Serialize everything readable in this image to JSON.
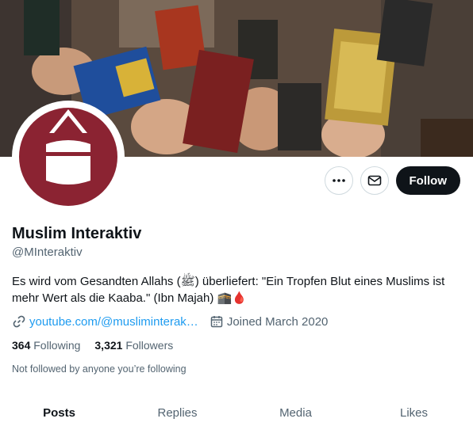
{
  "banner": {
    "description_icon": "crowd-holding-qurans-photo"
  },
  "avatar": {
    "icon": "kaaba-drop-logo",
    "color": "#8b2332"
  },
  "actions": {
    "more_icon": "ellipsis-icon",
    "message_icon": "envelope-icon",
    "follow_label": "Follow"
  },
  "profile": {
    "name": "Muslim Interaktiv",
    "handle": "@MInteraktiv",
    "bio": "Es wird vom Gesandten Allahs (ﷺ) überliefert: \"Ein Tropfen Blut eines Muslims ist mehr Wert als die Kaaba.\"  (Ibn Majah) 🕋🩸",
    "link": "youtube.com/@musliminterak…",
    "joined": "Joined March 2020"
  },
  "stats": {
    "following_count": "364",
    "following_label": "Following",
    "followers_count": "3,321",
    "followers_label": "Followers"
  },
  "not_followed": "Not followed by anyone you’re following",
  "tabs": [
    {
      "label": "Posts"
    },
    {
      "label": "Replies"
    },
    {
      "label": "Media"
    },
    {
      "label": "Likes"
    }
  ],
  "colors": {
    "accent": "#1d9bf0",
    "text": "#0f1419",
    "muted": "#536471"
  }
}
